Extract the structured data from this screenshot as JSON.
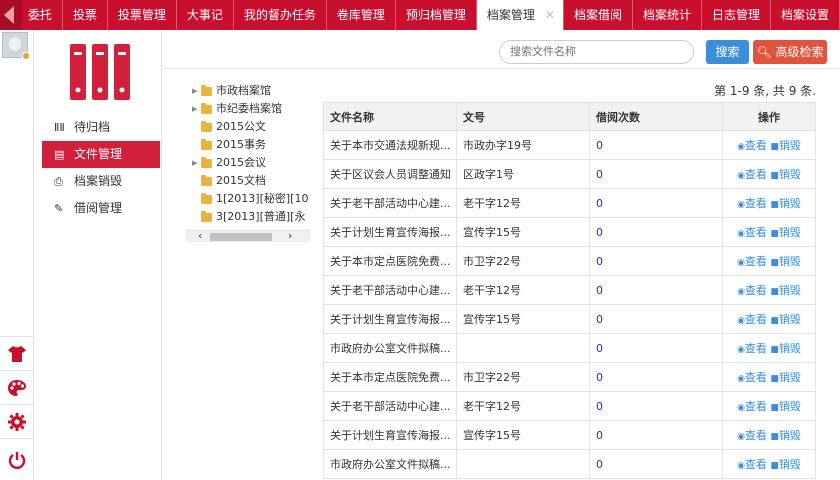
{
  "topnav": {
    "tabs": [
      {
        "label": "委托",
        "active": false
      },
      {
        "label": "投票",
        "active": false
      },
      {
        "label": "投票管理",
        "active": false
      },
      {
        "label": "大事记",
        "active": false
      },
      {
        "label": "我的督办任务",
        "active": false
      },
      {
        "label": "卷库管理",
        "active": false
      },
      {
        "label": "预归档管理",
        "active": false
      },
      {
        "label": "档案管理",
        "active": true
      },
      {
        "label": "档案借阅",
        "active": false
      },
      {
        "label": "档案统计",
        "active": false
      },
      {
        "label": "日志管理",
        "active": false
      },
      {
        "label": "档案设置",
        "active": false
      }
    ],
    "close_glyph": "✕"
  },
  "rail": {
    "icons": [
      "tshirt-icon",
      "palette-icon",
      "gear-icon",
      "power-icon"
    ]
  },
  "menu": {
    "items": [
      {
        "label": "待归档",
        "icon": "books-icon",
        "active": false
      },
      {
        "label": "文件管理",
        "icon": "folder-list-icon",
        "active": true
      },
      {
        "label": "档案销毁",
        "icon": "shredder-icon",
        "active": false
      },
      {
        "label": "借阅管理",
        "icon": "pencil-icon",
        "active": false
      }
    ]
  },
  "search": {
    "placeholder": "搜索文件名称",
    "search_label": "搜索",
    "advanced_label": "高级检索"
  },
  "tree": {
    "nodes": [
      {
        "label": "市政档案馆",
        "expandable": true
      },
      {
        "label": "市纪委档案馆",
        "expandable": true
      },
      {
        "label": "2015公文",
        "expandable": false
      },
      {
        "label": "2015事务",
        "expandable": false
      },
      {
        "label": "2015会议",
        "expandable": true
      },
      {
        "label": "2015文档",
        "expandable": false
      },
      {
        "label": "1[2013][秘密][10",
        "expandable": false
      },
      {
        "label": "3[2013][普通][永",
        "expandable": false
      }
    ]
  },
  "pagination": {
    "text": "第 1-9 条, 共 9 条."
  },
  "table": {
    "headers": [
      "文件名称",
      "文号",
      "借阅次数",
      "操作"
    ],
    "view_label": "查看",
    "destroy_label": "销毁",
    "rows": [
      {
        "name": "关于本市交通法规新规...",
        "number": "市政办字19号",
        "count": "0"
      },
      {
        "name": "关于区议会人员调整通知",
        "number": "区政字1号",
        "count": "0"
      },
      {
        "name": "关于老干部活动中心建...",
        "number": "老干字12号",
        "count": "0"
      },
      {
        "name": "关于计划生育宣传海报...",
        "number": "宣传字15号",
        "count": "0"
      },
      {
        "name": "关于本市定点医院免费...",
        "number": "市卫字22号",
        "count": "0"
      },
      {
        "name": "关于老干部活动中心建...",
        "number": "老干字12号",
        "count": "0"
      },
      {
        "name": "关于计划生育宣传海报...",
        "number": "宣传字15号",
        "count": "0"
      },
      {
        "name": "市政府办公室文件拟稿...",
        "number": "",
        "count": "0"
      },
      {
        "name": "关于本市定点医院免费...",
        "number": "市卫字22号",
        "count": "0"
      },
      {
        "name": "关于老干部活动中心建...",
        "number": "老干字12号",
        "count": "0"
      },
      {
        "name": "关于计划生育宣传海报...",
        "number": "宣传字15号",
        "count": "0"
      },
      {
        "name": "市政府办公室文件拟稿...",
        "number": "",
        "count": "0"
      }
    ]
  },
  "colors": {
    "brand": "#c8102e",
    "primary": "#3c8dda",
    "danger": "#e0533c"
  }
}
